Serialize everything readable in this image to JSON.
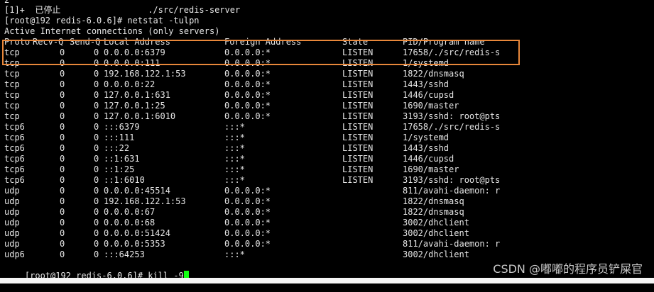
{
  "terminal": {
    "top_fragment": "2",
    "job_line": "[1]+  已停止                 ./src/redis-server",
    "command_line": "[root@192 redis-6.0.6]# netstat -tulpn",
    "info_line": "Active Internet connections (only servers)",
    "headers": {
      "proto": "Proto",
      "recv": "Recv-Q",
      "send": "Send-Q",
      "local": "Local Address",
      "foreign": "Foreign Address",
      "state": "State",
      "pid": "PID/Program name"
    },
    "rows": [
      {
        "proto": "tcp",
        "recv": "0",
        "send": "0",
        "local": "0.0.0.0:6379",
        "foreign": "0.0.0.0:*",
        "state": "LISTEN",
        "pid": "17658/./src/redis-s"
      },
      {
        "proto": "tcp",
        "recv": "0",
        "send": "0",
        "local": "0.0.0.0:111",
        "foreign": "0.0.0.0:*",
        "state": "LISTEN",
        "pid": "1/systemd"
      },
      {
        "proto": "tcp",
        "recv": "0",
        "send": "0",
        "local": "192.168.122.1:53",
        "foreign": "0.0.0.0:*",
        "state": "LISTEN",
        "pid": "1822/dnsmasq"
      },
      {
        "proto": "tcp",
        "recv": "0",
        "send": "0",
        "local": "0.0.0.0:22",
        "foreign": "0.0.0.0:*",
        "state": "LISTEN",
        "pid": "1443/sshd"
      },
      {
        "proto": "tcp",
        "recv": "0",
        "send": "0",
        "local": "127.0.0.1:631",
        "foreign": "0.0.0.0:*",
        "state": "LISTEN",
        "pid": "1446/cupsd"
      },
      {
        "proto": "tcp",
        "recv": "0",
        "send": "0",
        "local": "127.0.0.1:25",
        "foreign": "0.0.0.0:*",
        "state": "LISTEN",
        "pid": "1690/master"
      },
      {
        "proto": "tcp",
        "recv": "0",
        "send": "0",
        "local": "127.0.0.1:6010",
        "foreign": "0.0.0.0:*",
        "state": "LISTEN",
        "pid": "3193/sshd: root@pts"
      },
      {
        "proto": "tcp6",
        "recv": "0",
        "send": "0",
        "local": ":::6379",
        "foreign": ":::*",
        "state": "LISTEN",
        "pid": "17658/./src/redis-s"
      },
      {
        "proto": "tcp6",
        "recv": "0",
        "send": "0",
        "local": ":::111",
        "foreign": ":::*",
        "state": "LISTEN",
        "pid": "1/systemd"
      },
      {
        "proto": "tcp6",
        "recv": "0",
        "send": "0",
        "local": ":::22",
        "foreign": ":::*",
        "state": "LISTEN",
        "pid": "1443/sshd"
      },
      {
        "proto": "tcp6",
        "recv": "0",
        "send": "0",
        "local": "::1:631",
        "foreign": ":::*",
        "state": "LISTEN",
        "pid": "1446/cupsd"
      },
      {
        "proto": "tcp6",
        "recv": "0",
        "send": "0",
        "local": "::1:25",
        "foreign": ":::*",
        "state": "LISTEN",
        "pid": "1690/master"
      },
      {
        "proto": "tcp6",
        "recv": "0",
        "send": "0",
        "local": "::1:6010",
        "foreign": ":::*",
        "state": "LISTEN",
        "pid": "3193/sshd: root@pts"
      },
      {
        "proto": "udp",
        "recv": "0",
        "send": "0",
        "local": "0.0.0.0:45514",
        "foreign": "0.0.0.0:*",
        "state": "",
        "pid": "811/avahi-daemon: r"
      },
      {
        "proto": "udp",
        "recv": "0",
        "send": "0",
        "local": "192.168.122.1:53",
        "foreign": "0.0.0.0:*",
        "state": "",
        "pid": "1822/dnsmasq"
      },
      {
        "proto": "udp",
        "recv": "0",
        "send": "0",
        "local": "0.0.0.0:67",
        "foreign": "0.0.0.0:*",
        "state": "",
        "pid": "1822/dnsmasq"
      },
      {
        "proto": "udp",
        "recv": "0",
        "send": "0",
        "local": "0.0.0.0:68",
        "foreign": "0.0.0.0:*",
        "state": "",
        "pid": "3002/dhclient"
      },
      {
        "proto": "udp",
        "recv": "0",
        "send": "0",
        "local": "0.0.0.0:51424",
        "foreign": "0.0.0.0:*",
        "state": "",
        "pid": "3002/dhclient"
      },
      {
        "proto": "udp",
        "recv": "0",
        "send": "0",
        "local": "0.0.0.0:5353",
        "foreign": "0.0.0.0:*",
        "state": "",
        "pid": "811/avahi-daemon: r"
      },
      {
        "proto": "udp6",
        "recv": "0",
        "send": "0",
        "local": ":::64253",
        "foreign": ":::*",
        "state": "",
        "pid": "3002/dhclient"
      }
    ],
    "prompt_line": "[root@192 redis-6.0.6]# kill -9"
  },
  "watermark": "CSDN @嘟嘟的程序员铲屎官",
  "colors": {
    "highlight_border": "#e8873a",
    "cursor": "#11ff11"
  },
  "icons": {
    "cursor": "block-cursor-icon"
  }
}
